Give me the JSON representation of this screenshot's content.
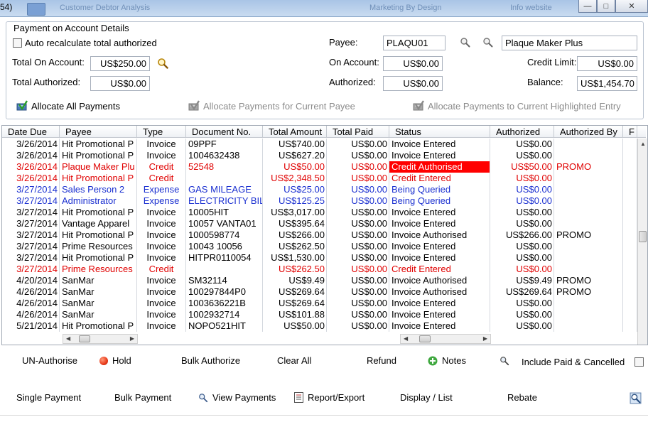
{
  "titlebar": {
    "app_number": "54)",
    "ghost_title": "Customer Debtor Analysis",
    "ghost_right_1": "Marketing By Design",
    "ghost_right_2": "Info website"
  },
  "details": {
    "section_title": "Payment on Account Details",
    "auto_recalc_label": "Auto recalculate total authorized",
    "total_on_account_label": "Total On Account:",
    "total_on_account_value": "US$250.00",
    "total_authorized_label": "Total Authorized:",
    "total_authorized_value": "US$0.00",
    "payee_label": "Payee:",
    "payee_code": "PLAQU01",
    "payee_name": "Plaque Maker Plus",
    "on_account_label": "On Account:",
    "on_account_value": "US$0.00",
    "authorized_label": "Authorized:",
    "authorized_value": "US$0.00",
    "credit_limit_label": "Credit Limit:",
    "credit_limit_value": "US$0.00",
    "balance_label": "Balance:",
    "balance_value": "US$1,454.70",
    "allocate_all": "Allocate All Payments",
    "allocate_payee": "Allocate Payments for Current Payee",
    "allocate_entry": "Allocate Payments to Current Highlighted Entry"
  },
  "grid": {
    "columns": [
      "Date Due",
      "Payee",
      "Type",
      "Document No.",
      "Total Amount",
      "Total Paid",
      "Status",
      "Authorized",
      "Authorized By",
      "F"
    ],
    "rows": [
      {
        "date": "3/26/2014",
        "payee": "Hit Promotional P",
        "type": "Invoice",
        "doc": "09PPF",
        "total": "US$740.00",
        "paid": "US$0.00",
        "status": "Invoice Entered",
        "auth": "US$0.00",
        "by": "",
        "color": "#000000",
        "highlight": false
      },
      {
        "date": "3/26/2014",
        "payee": "Hit Promotional P",
        "type": "Invoice",
        "doc": "1004632438",
        "total": "US$627.20",
        "paid": "US$0.00",
        "status": "Invoice Entered",
        "auth": "US$0.00",
        "by": "",
        "color": "#000000",
        "highlight": false
      },
      {
        "date": "3/26/2014",
        "payee": "Plaque Maker Plu",
        "type": "Credit",
        "doc": "52548",
        "total": "US$50.00",
        "paid": "US$0.00",
        "status": "Credit Authorised",
        "auth": "US$50.00",
        "by": "PROMO",
        "color": "#e00000",
        "highlight": true
      },
      {
        "date": "3/26/2014",
        "payee": "Hit Promotional P",
        "type": "Credit",
        "doc": "",
        "total": "US$2,348.50",
        "paid": "US$0.00",
        "status": "Credit Entered",
        "auth": "US$0.00",
        "by": "",
        "color": "#e00000",
        "highlight": false
      },
      {
        "date": "3/27/2014",
        "payee": "Sales Person 2",
        "type": "Expense",
        "doc": "GAS MILEAGE",
        "total": "US$25.00",
        "paid": "US$0.00",
        "status": "Being Queried",
        "auth": "US$0.00",
        "by": "",
        "color": "#1a2fd0",
        "highlight": false
      },
      {
        "date": "3/27/2014",
        "payee": "Administrator",
        "type": "Expense",
        "doc": "ELECTRICITY BIL",
        "total": "US$125.25",
        "paid": "US$0.00",
        "status": "Being Queried",
        "auth": "US$0.00",
        "by": "",
        "color": "#1a2fd0",
        "highlight": false
      },
      {
        "date": "3/27/2014",
        "payee": "Hit Promotional P",
        "type": "Invoice",
        "doc": "10005HIT",
        "total": "US$3,017.00",
        "paid": "US$0.00",
        "status": "Invoice Entered",
        "auth": "US$0.00",
        "by": "",
        "color": "#000000",
        "highlight": false
      },
      {
        "date": "3/27/2014",
        "payee": "Vantage Apparel",
        "type": "Invoice",
        "doc": "10057 VANTA01",
        "total": "US$395.64",
        "paid": "US$0.00",
        "status": "Invoice Entered",
        "auth": "US$0.00",
        "by": "",
        "color": "#000000",
        "highlight": false
      },
      {
        "date": "3/27/2014",
        "payee": "Hit Promotional P",
        "type": "Invoice",
        "doc": "1000598774",
        "total": "US$266.00",
        "paid": "US$0.00",
        "status": "Invoice Authorised",
        "auth": "US$266.00",
        "by": "PROMO",
        "color": "#000000",
        "highlight": false
      },
      {
        "date": "3/27/2014",
        "payee": "Prime Resources",
        "type": "Invoice",
        "doc": "10043 10056",
        "total": "US$262.50",
        "paid": "US$0.00",
        "status": "Invoice Entered",
        "auth": "US$0.00",
        "by": "",
        "color": "#000000",
        "highlight": false
      },
      {
        "date": "3/27/2014",
        "payee": "Hit Promotional P",
        "type": "Invoice",
        "doc": "HITPR0110054",
        "total": "US$1,530.00",
        "paid": "US$0.00",
        "status": "Invoice Entered",
        "auth": "US$0.00",
        "by": "",
        "color": "#000000",
        "highlight": false
      },
      {
        "date": "3/27/2014",
        "payee": "Prime Resources",
        "type": "Credit",
        "doc": "",
        "total": "US$262.50",
        "paid": "US$0.00",
        "status": "Credit Entered",
        "auth": "US$0.00",
        "by": "",
        "color": "#e00000",
        "highlight": false
      },
      {
        "date": "4/20/2014",
        "payee": "SanMar",
        "type": "Invoice",
        "doc": "SM32114",
        "total": "US$9.49",
        "paid": "US$0.00",
        "status": "Invoice Authorised",
        "auth": "US$9.49",
        "by": "PROMO",
        "color": "#000000",
        "highlight": false
      },
      {
        "date": "4/26/2014",
        "payee": "SanMar",
        "type": "Invoice",
        "doc": "100297844P0",
        "total": "US$269.64",
        "paid": "US$0.00",
        "status": "Invoice Authorised",
        "auth": "US$269.64",
        "by": "PROMO",
        "color": "#000000",
        "highlight": false
      },
      {
        "date": "4/26/2014",
        "payee": "SanMar",
        "type": "Invoice",
        "doc": "1003636221B",
        "total": "US$269.64",
        "paid": "US$0.00",
        "status": "Invoice Entered",
        "auth": "US$0.00",
        "by": "",
        "color": "#000000",
        "highlight": false
      },
      {
        "date": "4/26/2014",
        "payee": "SanMar",
        "type": "Invoice",
        "doc": "1002932714",
        "total": "US$101.88",
        "paid": "US$0.00",
        "status": "Invoice Entered",
        "auth": "US$0.00",
        "by": "",
        "color": "#000000",
        "highlight": false
      },
      {
        "date": "5/21/2014",
        "payee": "Hit Promotional P",
        "type": "Invoice",
        "doc": "NOPO521HIT",
        "total": "US$50.00",
        "paid": "US$0.00",
        "status": "Invoice Entered",
        "auth": "US$0.00",
        "by": "",
        "color": "#000000",
        "highlight": false
      }
    ]
  },
  "actions": {
    "unauthorise": "UN-Authorise",
    "hold": "Hold",
    "bulk_authorize": "Bulk Authorize",
    "clear_all": "Clear All",
    "refund": "Refund",
    "notes": "Notes",
    "include_paid": "Include Paid & Cancelled"
  },
  "bottom": {
    "single_payment": "Single Payment",
    "bulk_payment": "Bulk Payment",
    "view_payments": "View Payments",
    "report_export": "Report/Export",
    "display_list": "Display / List",
    "rebate": "Rebate"
  },
  "colors": {
    "credit_red": "#e00000",
    "expense_blue": "#1a2fd0",
    "highlight_bg": "#ff0000",
    "hold_dot": "#e83a1a",
    "notes_dot": "#3fa83f"
  }
}
